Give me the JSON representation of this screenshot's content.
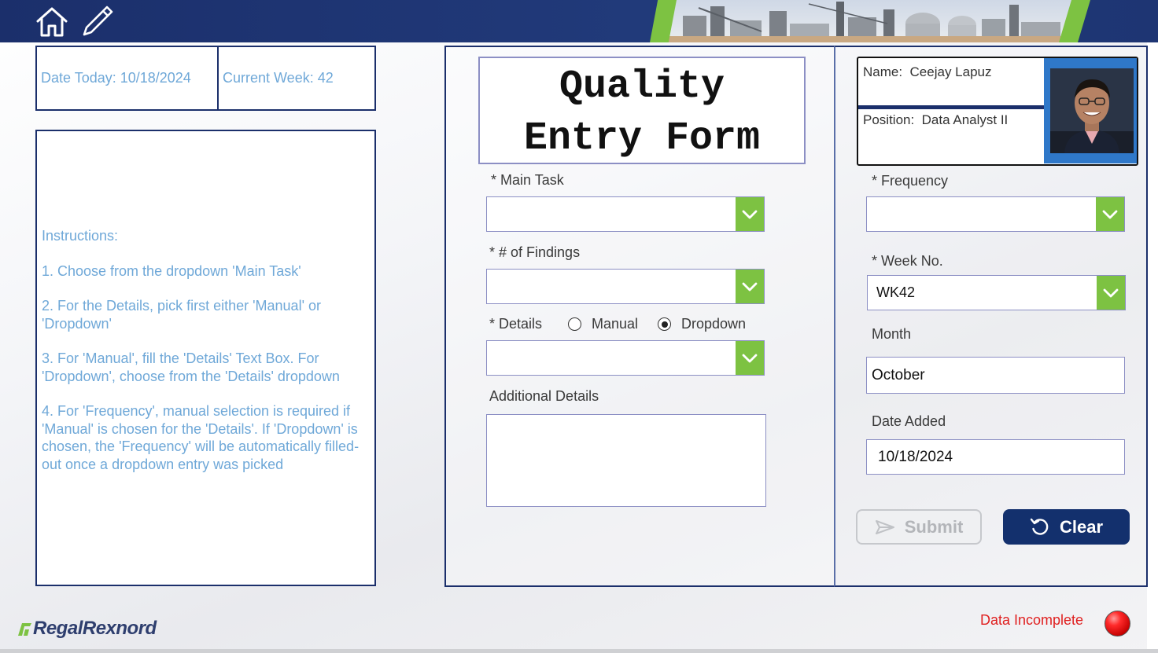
{
  "header": {
    "home_icon": "home-icon",
    "edit_icon": "pencil-icon",
    "banner_image": "industrial-plant-banner",
    "color": "#1b2f6b",
    "accent": "#7dc242"
  },
  "info": {
    "date_today": "Date Today: 10/18/2024",
    "current_week": "Current Week: 42"
  },
  "instructions": {
    "heading": "Instructions:",
    "step1": "1. Choose from the dropdown 'Main Task'",
    "step2": "2. For the Details, pick first either 'Manual' or 'Dropdown'",
    "step3": "3. For 'Manual', fill the 'Details' Text Box. For 'Dropdown', choose from the 'Details' dropdown",
    "step4": "4. For 'Frequency', manual selection is required if 'Manual' is chosen for the 'Details'. If 'Dropdown' is chosen, the 'Frequency' will be automatically filled-out once a dropdown entry was picked"
  },
  "form": {
    "title_line1": "Quality",
    "title_line2": "Entry Form",
    "main_task": {
      "label": "* Main Task",
      "value": ""
    },
    "findings": {
      "label": "* # of Findings",
      "value": ""
    },
    "details": {
      "label": "* Details",
      "options": [
        "Manual",
        "Dropdown"
      ],
      "selected": "Dropdown",
      "value": ""
    },
    "additional_details": {
      "label": "Additional Details",
      "value": ""
    }
  },
  "profile": {
    "name_label": "Name:",
    "name_value": "Ceejay Lapuz",
    "position_label": "Position:",
    "position_value": "Data Analyst II"
  },
  "right_form": {
    "frequency": {
      "label": "* Frequency",
      "value": ""
    },
    "week_no": {
      "label": "* Week No.",
      "value": "WK42"
    },
    "month": {
      "label": "Month",
      "value": "October"
    },
    "date_added": {
      "label": "Date Added",
      "value": "10/18/2024"
    }
  },
  "buttons": {
    "submit": "Submit",
    "clear": "Clear"
  },
  "footer": {
    "logo": "RegalRexnord",
    "status": "Data Incomplete",
    "status_color": "#e02020"
  }
}
